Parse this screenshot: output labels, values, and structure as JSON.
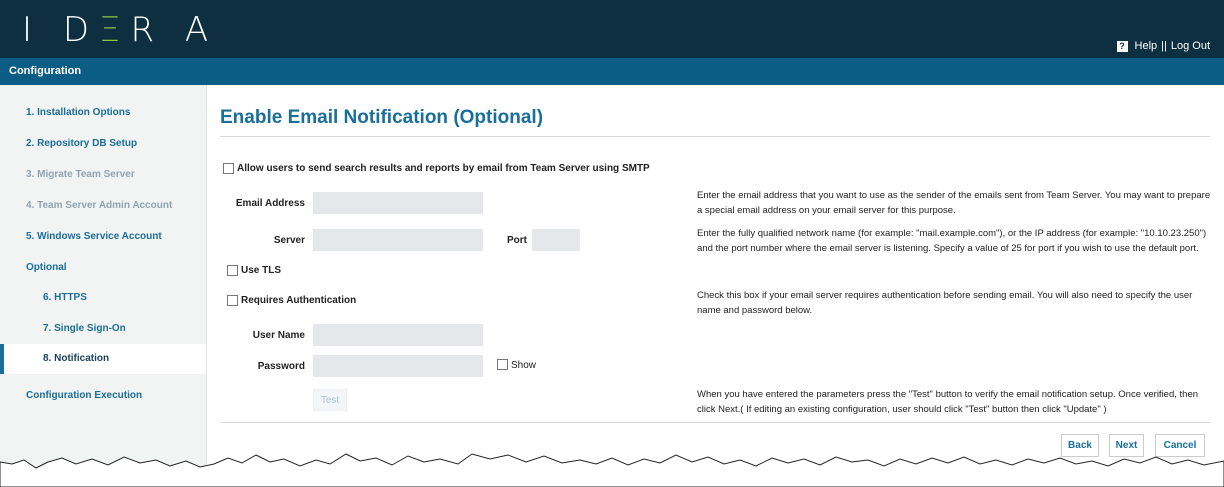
{
  "header": {
    "logo_text": "IDERA",
    "help_label": "Help",
    "separator": "||",
    "logout_label": "Log Out",
    "help_icon_glyph": "?"
  },
  "subheader": {
    "title": "Configuration"
  },
  "sidebar": {
    "items": [
      {
        "label": "1. Installation Options",
        "state": "link"
      },
      {
        "label": "2. Repository DB Setup",
        "state": "link"
      },
      {
        "label": "3. Migrate Team Server",
        "state": "disabled"
      },
      {
        "label": "4. Team Server Admin Account",
        "state": "disabled"
      },
      {
        "label": "5. Windows Service Account",
        "state": "link"
      },
      {
        "label": "Optional",
        "state": "link"
      },
      {
        "label": "6. HTTPS",
        "state": "link"
      },
      {
        "label": "7. Single Sign-On",
        "state": "link"
      },
      {
        "label": "8. Notification",
        "state": "active"
      },
      {
        "label": "Configuration Execution",
        "state": "link"
      }
    ]
  },
  "main": {
    "title": "Enable Email Notification (Optional)",
    "allow_smtp_label": "Allow users to send search results and reports by email from Team Server using SMTP",
    "email_address_label": "Email Address",
    "email_address_value": "",
    "email_help": "Enter the email address that you want to use as the sender of the emails sent from Team Server. You may want to prepare a special email address on your email server for this purpose.",
    "server_label": "Server",
    "server_value": "",
    "port_label": "Port",
    "port_value": "",
    "server_help": "Enter the fully qualified network name (for example: \"mail.example.com\"), or the IP address (for example: \"10.10.23.250\") and the port number where the email server is listening. Specify a value of 25 for port if you wish to use the default port.",
    "use_tls_label": "Use TLS",
    "requires_auth_label": "Requires Authentication",
    "auth_help": "Check this box if your email server requires authentication before sending email. You will also need to specify the user name and password below.",
    "username_label": "User Name",
    "username_value": "",
    "password_label": "Password",
    "password_value": "",
    "show_label": "Show",
    "test_label": "Test",
    "test_help": "When you have entered the parameters press the \"Test\" button to verify the email notification setup. Once verified, then click Next.( If editing an existing configuration, user should click \"Test\" button then click \"Update\" )"
  },
  "footer": {
    "back_label": "Back",
    "next_label": "Next",
    "cancel_label": "Cancel"
  },
  "colors": {
    "topbar": "#0d2f40",
    "subbar": "#0c5d86",
    "accent": "#1a6e9c",
    "logo_accent": "#8cc63f",
    "sidebar_bg": "#f2f3f3",
    "field_bg": "#e6e7ea"
  }
}
